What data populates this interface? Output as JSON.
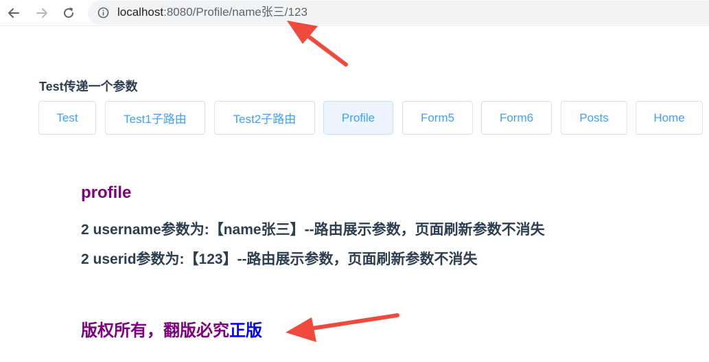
{
  "browser": {
    "url_host": "localhost",
    "url_rest": ":8080/Profile/name张三/123",
    "icons": [
      "back-icon",
      "forward-icon",
      "reload-icon",
      "info-icon"
    ]
  },
  "page": {
    "heading": "Test传递一个参数",
    "nav_buttons": [
      {
        "label": "Test",
        "active": false
      },
      {
        "label": "Test1子路由",
        "active": false
      },
      {
        "label": "Test2子路由",
        "active": false
      },
      {
        "label": "Profile",
        "active": true
      },
      {
        "label": "Form5",
        "active": false
      },
      {
        "label": "Form6",
        "active": false
      },
      {
        "label": "Posts",
        "active": false
      },
      {
        "label": "Home",
        "active": false
      }
    ],
    "profile_title": "profile",
    "username_line": "2 username参数为:【name张三】--路由展示参数，页面刷新参数不消失",
    "userid_line": "2 userid参数为:【123】--路由展示参数，页面刷新参数不消失",
    "copyright_purple": "版权所有，翻版必究",
    "copyright_blue": "正版"
  },
  "colors": {
    "button_text": "#409eff",
    "active_button_bg": "#ecf5ff",
    "purple": "#800080",
    "blue": "#0000ff",
    "arrow": "#f04a3c"
  }
}
